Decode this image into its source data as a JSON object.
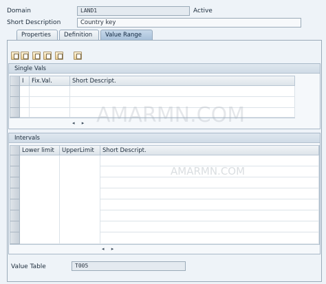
{
  "header": {
    "domain_label": "Domain",
    "domain_value": "LAND1",
    "status": "Active",
    "short_desc_label": "Short Description",
    "short_desc_value": "Country key"
  },
  "tabs": [
    {
      "label": "Properties",
      "active": false
    },
    {
      "label": "Definition",
      "active": false
    },
    {
      "label": "Value Range",
      "active": true
    }
  ],
  "single_vals": {
    "title": "Single Vals",
    "columns": [
      "I",
      "Fix.Val.",
      "Short Descript."
    ],
    "scroll": "◂ ▸"
  },
  "intervals": {
    "title": "Intervals",
    "columns": [
      "Lower limit",
      "UpperLimit",
      "Short Descript."
    ],
    "scroll": "◂ ▸"
  },
  "value_table": {
    "label": "Value Table",
    "value": "T005"
  },
  "watermark": "AMARMN.COM",
  "toolbar_icons": [
    "cut-icon",
    "copy-icon",
    "insert-row-icon",
    "delete-row-icon",
    "select-all-icon"
  ]
}
